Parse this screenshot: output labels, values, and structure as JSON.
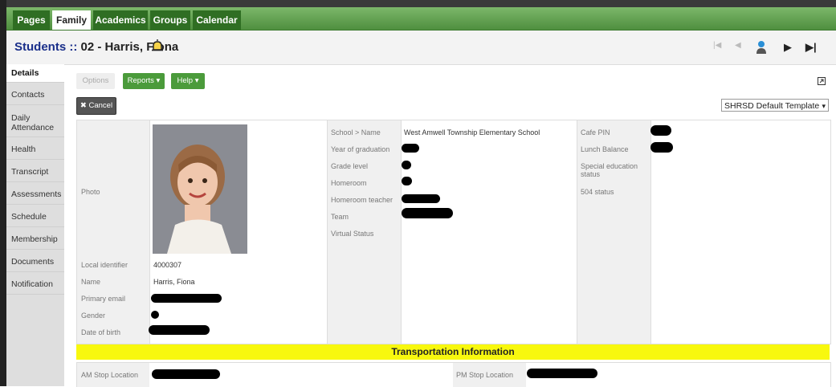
{
  "nav": {
    "tabs": [
      "Pages",
      "Family",
      "Academics",
      "Groups",
      "Calendar"
    ],
    "active": "Family"
  },
  "header": {
    "title_prefix": "Students :: ",
    "title_rest": "02 - Harris, Fiona"
  },
  "pager": {
    "first": "|◀",
    "prev": "◀",
    "next": "▶",
    "last": "▶|"
  },
  "sidebar": {
    "items": [
      "Details",
      "Contacts",
      "Daily Attendance",
      "Health",
      "Transcript",
      "Assessments",
      "Schedule",
      "Membership",
      "Documents",
      "Notification"
    ],
    "active": "Details"
  },
  "toolbar": {
    "options": "Options",
    "reports": "Reports ▾",
    "help": "Help ▾",
    "cancel": "✖ Cancel",
    "template": "SHRSD Default Template"
  },
  "photo_label": "Photo",
  "left_fields": [
    {
      "label": "Local identifier",
      "value": "4000307"
    },
    {
      "label": "Name",
      "value": "Harris, Fiona"
    },
    {
      "label": "Primary email",
      "value": ""
    },
    {
      "label": "Gender",
      "value": ""
    },
    {
      "label": "Date of birth",
      "value": ""
    }
  ],
  "mid_fields": [
    {
      "label": "School > Name",
      "value": "West Amwell Township Elementary School"
    },
    {
      "label": "Year of graduation",
      "value": ""
    },
    {
      "label": "Grade level",
      "value": ""
    },
    {
      "label": "Homeroom",
      "value": ""
    },
    {
      "label": "Homeroom teacher",
      "value": ""
    },
    {
      "label": "Team",
      "value": ""
    },
    {
      "label": "Virtual Status",
      "value": ""
    }
  ],
  "right_fields": [
    {
      "label": "Cafe PIN",
      "value": ""
    },
    {
      "label": "Lunch Balance",
      "value": ""
    },
    {
      "label": "Special education status",
      "value": ""
    },
    {
      "label": "504 status",
      "value": ""
    }
  ],
  "transport": {
    "heading": "Transportation Information",
    "am_label": "AM Stop Location",
    "pm_label": "PM Stop Location"
  }
}
